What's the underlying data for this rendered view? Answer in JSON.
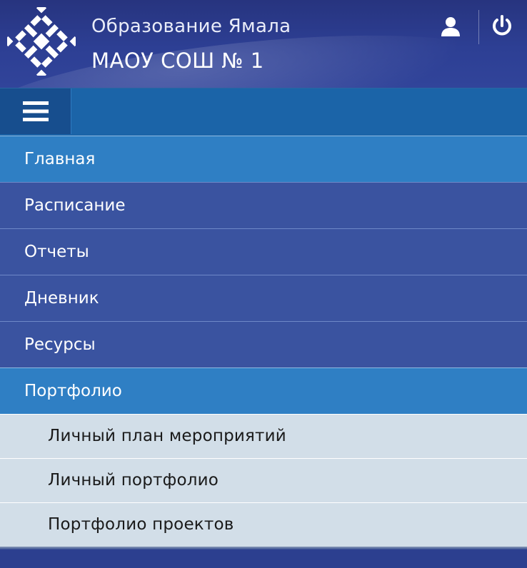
{
  "header": {
    "subtitle": "Образование Ямала",
    "title": "МАОУ СОШ № 1",
    "logo_icon": "yamal-ornament-logo",
    "user_icon": "user-icon",
    "power_icon": "power-icon"
  },
  "toolbar": {
    "menu_icon": "hamburger-menu-icon"
  },
  "nav": {
    "items": [
      {
        "label": "Главная",
        "active": true
      },
      {
        "label": "Расписание",
        "active": false
      },
      {
        "label": "Отчеты",
        "active": false
      },
      {
        "label": "Дневник",
        "active": false
      },
      {
        "label": "Ресурсы",
        "active": false
      },
      {
        "label": "Портфолио",
        "active": true
      }
    ],
    "submenu": [
      {
        "label": "Личный план мероприятий"
      },
      {
        "label": "Личный портфолио"
      },
      {
        "label": "Портфолио проектов"
      }
    ]
  },
  "colors": {
    "header_bg": "#2d3f94",
    "nav_bg": "#3a53a0",
    "nav_active": "#2f7fc4",
    "submenu_bg": "#d2dee8"
  }
}
